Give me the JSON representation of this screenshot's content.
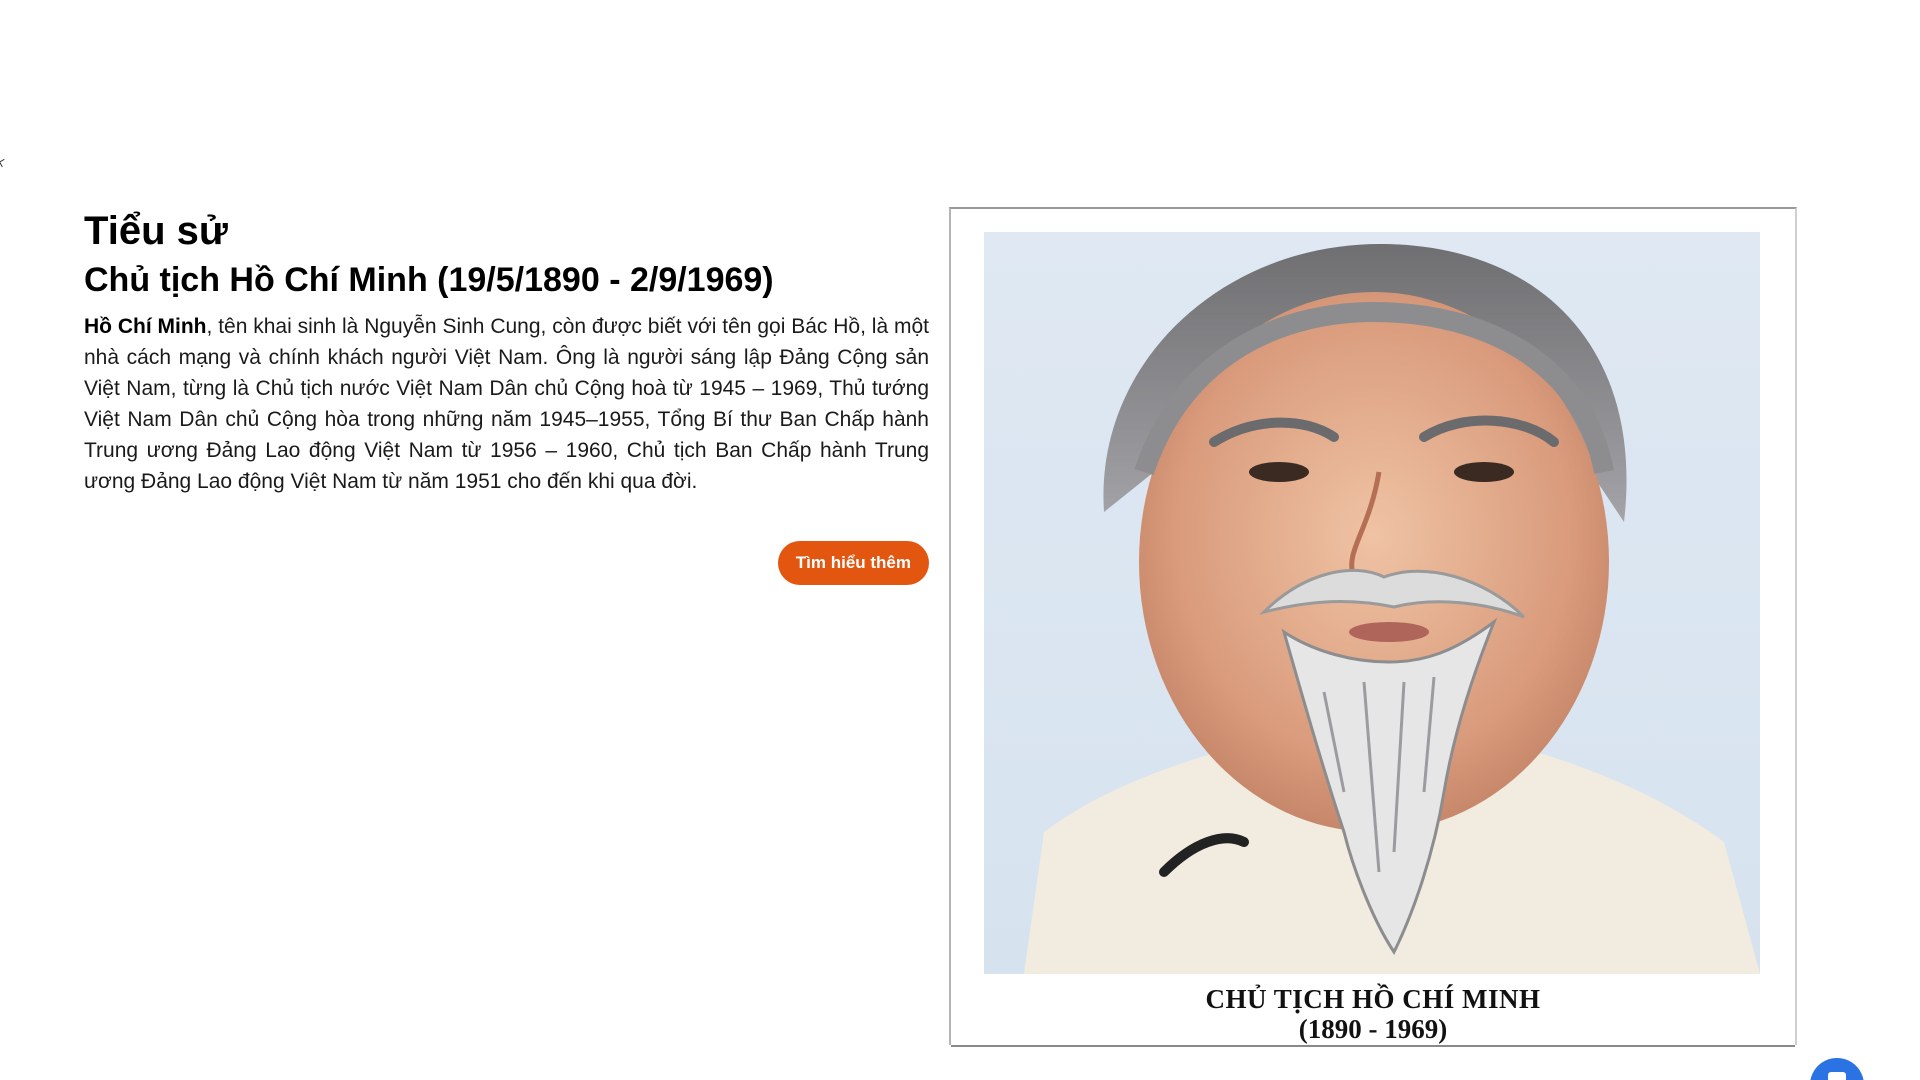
{
  "bio": {
    "heading": "Tiểu sử",
    "subheading": "Chủ tịch Hồ Chí Minh (19/5/1890 - 2/9/1969)",
    "name_bold": "Hồ Chí Minh",
    "text": ", tên khai sinh là Nguyễn Sinh Cung, còn được biết với tên gọi Bác Hồ, là một nhà cách mạng và chính khách người Việt Nam. Ông là người sáng lập Đảng Cộng sản Việt Nam, từng là Chủ tịch nước Việt Nam Dân chủ Cộng hoà từ 1945 – 1969, Thủ tướng Việt Nam Dân chủ Cộng hòa trong những năm 1945–1955, Tổng Bí thư Ban Chấp hành Trung ương Đảng Lao động Việt Nam từ 1956 – 1960, Chủ tịch Ban Chấp hành Trung ương Đảng Lao động Việt Nam từ năm 1951 cho đến khi qua đời.",
    "button_label": "Tìm hiểu thêm"
  },
  "portrait": {
    "caption_name": "CHỦ TỊCH HỒ CHÍ MINH",
    "caption_years": "(1890 - 1969)"
  },
  "chat": {
    "icon": "chat-bubble-icon"
  },
  "colors": {
    "accent": "#e2560f",
    "chat": "#2b73e3"
  }
}
